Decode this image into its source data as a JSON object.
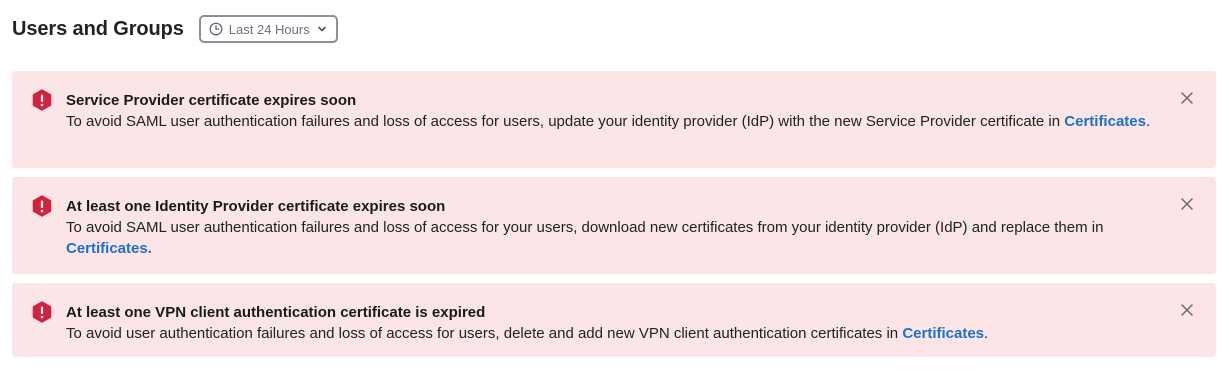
{
  "page": {
    "title": "Users and Groups"
  },
  "time_filter": {
    "label": "Last 24 Hours",
    "icon": "clock-icon",
    "dropdown_icon": "chevron-down-icon"
  },
  "colors": {
    "alert_background": "#fbe5e7",
    "alert_icon": "#d4213d",
    "link": "#1d6fc9"
  },
  "alerts": [
    {
      "icon": "error-shield-icon",
      "title": "Service Provider certificate expires soon",
      "message_before": "To avoid SAML user authentication failures and loss of access for users, update your identity provider (IdP) with the new Service Provider certificate in ",
      "link": "Certificates",
      "message_after": ".",
      "close_icon": "close-icon"
    },
    {
      "icon": "error-shield-icon",
      "title": "At least one Identity Provider certificate expires soon",
      "message_before": "To avoid SAML user authentication failures and loss of access for your users, download new certificates from your identity provider (IdP) and replace them in ",
      "link": "Certificates.",
      "message_after": "",
      "close_icon": "close-icon"
    },
    {
      "icon": "error-shield-icon",
      "title": "At least one VPN client authentication certificate is expired",
      "message_before": "To avoid user authentication failures and loss of access for users, delete and add new VPN client authentication certificates in ",
      "link": "Certificates",
      "message_after": ".",
      "close_icon": "close-icon"
    }
  ]
}
